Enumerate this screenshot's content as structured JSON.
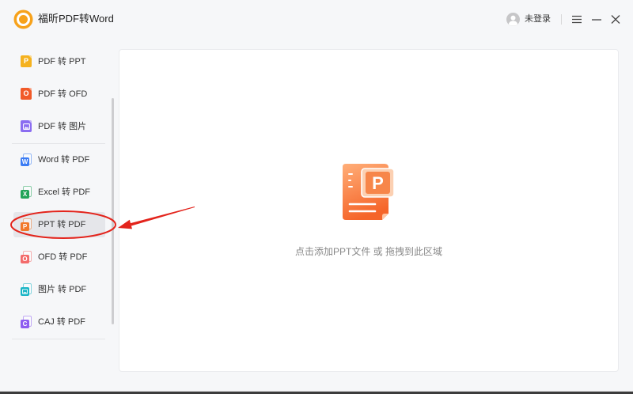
{
  "app": {
    "title": "福昕PDF转Word",
    "logo_icon": "foxit-logo-icon",
    "brand_color": "#f7a21b"
  },
  "titlebar": {
    "avatar_icon": "user-avatar-icon",
    "login_status": "未登录",
    "menu_icon": "menu-icon",
    "minimize_icon": "minimize-icon",
    "close_icon": "close-icon"
  },
  "sidebar": {
    "groups": [
      {
        "items": [
          {
            "label": "PDF 转 PPT",
            "icon": "ppt-icon",
            "glyph": "P",
            "color": "#f5b21f",
            "active": false
          },
          {
            "label": "PDF 转 OFD",
            "icon": "ofd-icon",
            "glyph": "O",
            "color": "#f15a29",
            "active": false
          },
          {
            "label": "PDF 转 图片",
            "icon": "image-icon",
            "color": "#8b6df1",
            "active": false
          }
        ]
      },
      {
        "items": [
          {
            "label": "Word 转 PDF",
            "icon": "word-icon",
            "glyph": "W",
            "color": "#3b7cf4",
            "active": false
          },
          {
            "label": "Excel 转 PDF",
            "icon": "excel-icon",
            "glyph": "X",
            "color": "#21a459",
            "active": false
          },
          {
            "label": "PPT 转 PDF",
            "icon": "ppt-icon",
            "glyph": "P",
            "color": "#f2792b",
            "active": true
          },
          {
            "label": "OFD 转 PDF",
            "icon": "ofd-icon",
            "glyph": "O",
            "color": "#f36b6b",
            "active": false
          },
          {
            "label": "图片 转 PDF",
            "icon": "image-icon",
            "color": "#19b5c6",
            "active": false
          },
          {
            "label": "CAJ 转 PDF",
            "icon": "caj-icon",
            "glyph": "C",
            "color": "#8e5df0",
            "active": false
          }
        ]
      }
    ]
  },
  "main": {
    "drop_icon": "ppt-file-icon",
    "drop_badge_letter": "P",
    "drop_hint": "点击添加PPT文件 或 拖拽到此区域",
    "accent_color": "#f7864a"
  },
  "annotation": {
    "color": "#e3241c"
  }
}
